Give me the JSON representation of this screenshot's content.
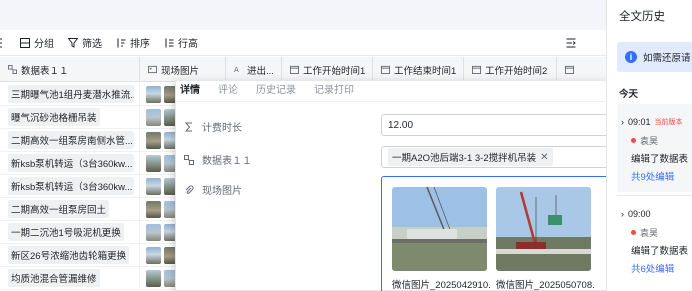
{
  "toolbar": {
    "group_label": "分组",
    "filter_label": "筛选",
    "sort_label": "排序",
    "rowheight_label": "行高"
  },
  "grid": {
    "columns": [
      "数据表１１",
      "现场图片",
      "进出...",
      "工作开始时间1",
      "工作结束时间1",
      "工作开始时间2",
      ""
    ],
    "rows": [
      "三期曝气池1组丹麦潜水推流...",
      "曝气沉砂池格栅吊装",
      "二期高效一组泵房南侧水管...",
      "新ksb泵机转运（3台360kw...",
      "新ksb泵机转运（3台360kw...",
      "二期高效一组泵房回土",
      "一期二沉池1号吸泥机更换",
      "新区26号浓缩池齿轮箱更换",
      "均质池混合管漏维修"
    ]
  },
  "panel": {
    "tabs": [
      "详情",
      "评论",
      "历史记录",
      "记录打印"
    ],
    "fields": {
      "duration_label": "计费时长",
      "duration_value": "12.00",
      "datatable_label": "数据表１１",
      "datatable_tag": "一期A2O池后端3-1 3-2搅拌机吊装",
      "photo_label": "现场图片"
    },
    "photos": [
      "微信图片_2025042910...",
      "微信图片_2025050708..."
    ]
  },
  "sidebar": {
    "title": "全文历史",
    "notice": "如需还原请",
    "today_label": "今天",
    "entries": [
      {
        "time": "09:01",
        "badge": "当前版本",
        "author": "袁昊",
        "action": "编辑了数据表",
        "link": "共9处编辑"
      },
      {
        "time": "09:00",
        "badge": "",
        "author": "袁昊",
        "action": "编辑了数据表",
        "link": "共6处编辑"
      }
    ]
  },
  "colors": {
    "accent": "#3370ff",
    "notice_bg": "#e1eaff",
    "badge_red": "#f54a45"
  }
}
